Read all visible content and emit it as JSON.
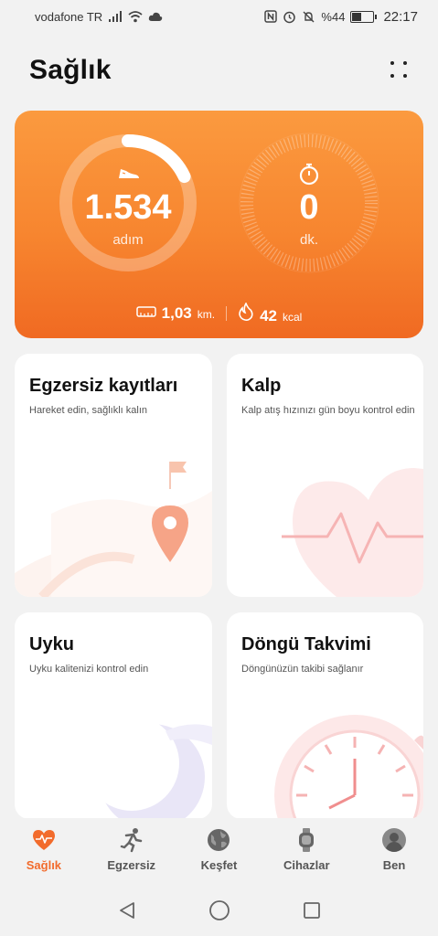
{
  "status_bar": {
    "carrier": "vodafone TR",
    "battery": "%44",
    "battery_level": 0.44,
    "time": "22:17"
  },
  "header": {
    "title": "Sağlık"
  },
  "activity": {
    "steps_value": "1.534",
    "steps_unit": "adım",
    "steps_progress": 0.18,
    "timer_value": "0",
    "timer_unit": "dk.",
    "distance_value": "1,03",
    "distance_unit": "km.",
    "calories_value": "42",
    "calories_unit": "kcal",
    "colors": {
      "start": "#fb9a3f",
      "end": "#f06a22"
    }
  },
  "cards": [
    {
      "title": "Egzersiz kayıtları",
      "subtitle": "Hareket edin, sağlıklı kalın"
    },
    {
      "title": "Kalp",
      "subtitle": "Kalp atış hızınızı gün boyu kontrol edin"
    },
    {
      "title": "Uyku",
      "subtitle": "Uyku kalitenizi kontrol edin"
    },
    {
      "title": "Döngü Takvimi",
      "subtitle": "Döngünüzün takibi sağlanır"
    }
  ],
  "bottom_nav": [
    {
      "label": "Sağlık",
      "icon": "heart-icon",
      "active": true
    },
    {
      "label": "Egzersiz",
      "icon": "running-icon",
      "active": false
    },
    {
      "label": "Keşfet",
      "icon": "globe-icon",
      "active": false
    },
    {
      "label": "Cihazlar",
      "icon": "watch-icon",
      "active": false
    },
    {
      "label": "Ben",
      "icon": "profile-icon",
      "active": false
    }
  ],
  "accent_color": "#f26b2c"
}
